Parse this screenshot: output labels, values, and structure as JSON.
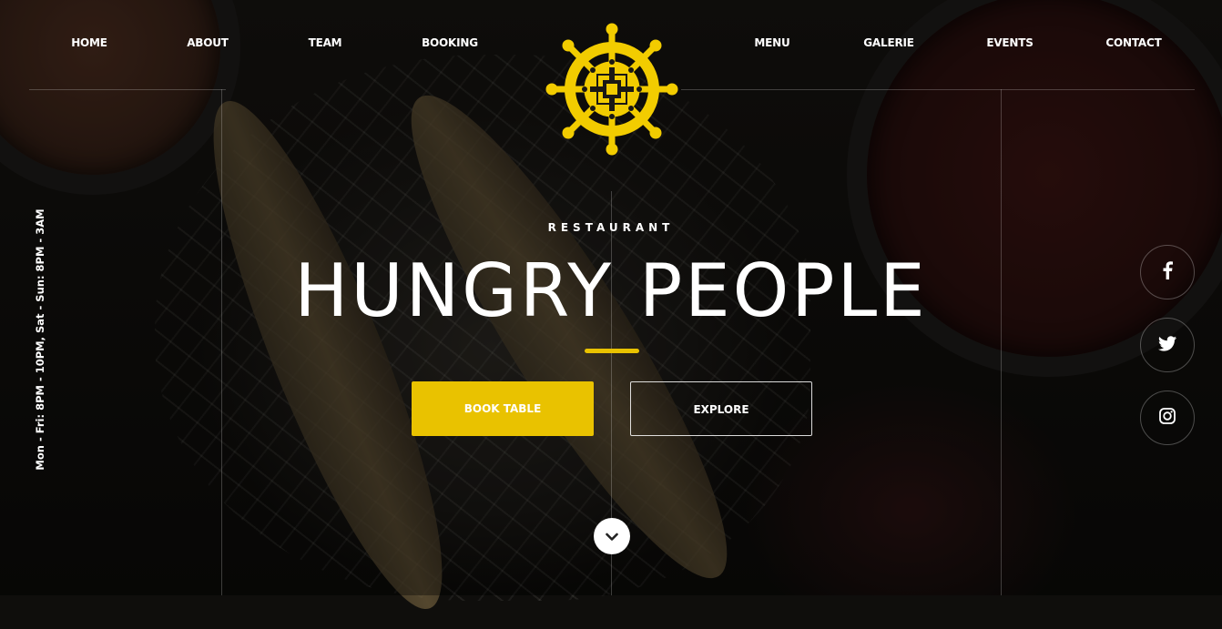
{
  "nav": {
    "left": [
      "HOME",
      "ABOUT",
      "TEAM",
      "BOOKING"
    ],
    "right": [
      "MENU",
      "GALERIE",
      "EVENTS",
      "CONTACT"
    ]
  },
  "logo": {
    "icon": "ship-wheel-icon",
    "color": "#f2cc00"
  },
  "hero": {
    "kicker": "RESTAURANT",
    "title": "HUNGRY PEOPLE",
    "primary_button": "BOOK TABLE",
    "secondary_button": "EXPLORE",
    "accent_color": "#e9c200"
  },
  "hours": "Mon - Fri: 8PM - 10PM, Sat - Sun: 8PM - 3AM",
  "social": [
    "facebook-icon",
    "twitter-icon",
    "instagram-icon"
  ],
  "scroll": {
    "icon": "chevron-down-icon"
  }
}
